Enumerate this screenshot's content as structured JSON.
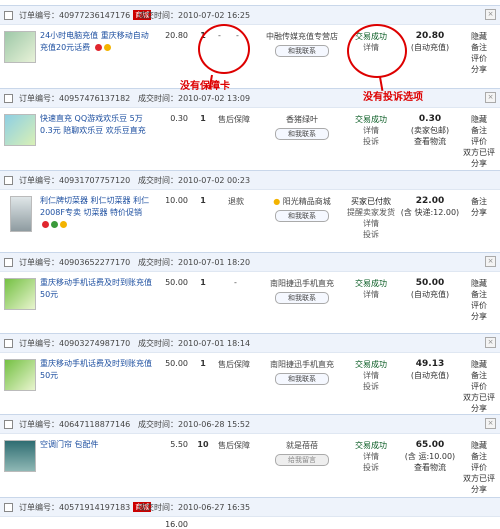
{
  "labels": {
    "order_no": "订单编号：",
    "deal_time": "成交时间：",
    "mall": "商城"
  },
  "orders": [
    {
      "no": "40977236147176",
      "mall": true,
      "time": "2010-07-02 16:25",
      "title": "24小时电脑充值 重庆移动自动充值20元话费",
      "price": "20.80",
      "qty": "1",
      "service": "-",
      "service2": "-",
      "seller": "中融传媒充值专营店",
      "chat": "和我联系",
      "status": [
        "交易成功",
        "详情"
      ],
      "total": "20.80",
      "total_note": "(自动充值)",
      "ops": [
        "隐藏",
        "备注",
        "评价",
        "分享"
      ]
    },
    {
      "no": "40957476137182",
      "mall": false,
      "time": "2010-07-02 13:09",
      "title": "快速直充 QQ游戏欢乐豆 5万 0.3元 陪聊欢乐豆 欢乐豆直充",
      "price": "0.30",
      "qty": "1",
      "service": "售后保障",
      "seller": "香猪绿叶",
      "chat": "和我联系",
      "status": [
        "交易成功",
        "详情",
        "投诉"
      ],
      "total": "0.30",
      "total_note": "(卖家包邮)",
      "total_link": "查看物流",
      "ops": [
        "隐藏",
        "备注",
        "评价",
        "双方已评",
        "分享"
      ]
    },
    {
      "no": "40931707757120",
      "mall": false,
      "time": "2010-07-02 00:23",
      "title": "利仁牌切菜器 利仁切菜器 利仁2008F专卖 切菜器 特价促销",
      "price": "10.00",
      "qty": "1",
      "service": "退款",
      "seller": "阳光精品商城",
      "chat": "和我联系",
      "status": [
        "买家已付款",
        "提醒卖家发货",
        "详情",
        "投诉"
      ],
      "total": "22.00",
      "total_note": "(含 快递:12.00)",
      "ops": [
        "备注",
        "分享"
      ]
    },
    {
      "no": "40903652277170",
      "mall": false,
      "time": "2010-07-01 18:20",
      "title": "重庆移动手机话费及时到账充值50元",
      "price": "50.00",
      "qty": "1",
      "service": "-",
      "seller": "南阳捷迅手机直充",
      "chat": "和我联系",
      "status": [
        "交易成功",
        "详情"
      ],
      "total": "50.00",
      "total_note": "(自动充值)",
      "ops": [
        "隐藏",
        "备注",
        "评价",
        "分享"
      ]
    },
    {
      "no": "40903274987170",
      "mall": false,
      "time": "2010-07-01 18:14",
      "title": "重庆移动手机话费及时到账充值50元",
      "price": "50.00",
      "qty": "1",
      "service": "售后保障",
      "seller": "南阳捷迅手机直充",
      "chat": "和我联系",
      "status": [
        "交易成功",
        "详情",
        "投诉"
      ],
      "total": "49.13",
      "total_note": "(自动充值)",
      "ops": [
        "隐藏",
        "备注",
        "评价",
        "双方已评",
        "分享"
      ]
    },
    {
      "no": "40647118877146",
      "mall": false,
      "time": "2010-06-28 15:52",
      "title": "空调门帘 包配件",
      "price": "5.50",
      "qty": "10",
      "service": "售后保障",
      "seller": "就是蓓蓓",
      "chat": "给我留言",
      "status": [
        "交易成功",
        "详情",
        "投诉"
      ],
      "total": "65.00",
      "total_note": "(含 运:10.00)",
      "total_link": "查看物流",
      "ops": [
        "隐藏",
        "备注",
        "评价",
        "双方已评",
        "分享"
      ]
    },
    {
      "no": "40571914197183",
      "mall": true,
      "time": "2010-06-27 16:35",
      "title": "",
      "price": "16.00",
      "qty": "1",
      "service": "",
      "seller": "",
      "chat": "",
      "status": [],
      "total": "",
      "total_note": "",
      "ops": []
    }
  ],
  "annotations": {
    "no_guarantee": "没有保障卡",
    "no_complaint": "没有投诉选项"
  },
  "colors": {
    "header_bg": "#eef3fb",
    "link": "#1d4fa0",
    "success": "#0a5c24",
    "annotation": "#dd0000"
  }
}
